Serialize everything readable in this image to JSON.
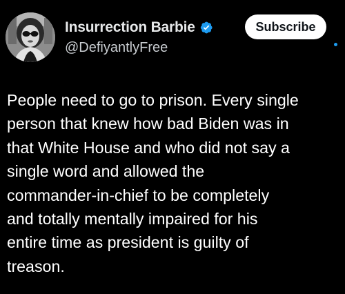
{
  "author": {
    "display_name": "Insurrection Barbie",
    "handle": "@DefiyantlyFree",
    "verified_icon": "verified-badge-icon",
    "avatar_icon": "profile-avatar"
  },
  "actions": {
    "subscribe_label": "Subscribe"
  },
  "post": {
    "lines": [
      "People need to go to prison. Every single",
      "person that knew how bad Biden was in",
      "that White House and who did not say a",
      "single word and allowed the",
      "commander-in-chief to be completely",
      "and totally mentally impaired for his",
      "entire time as president is guilty of",
      "treason."
    ]
  },
  "colors": {
    "background": "#000000",
    "text": "#ffffff",
    "secondary_text": "#c9cdd1",
    "accent": "#1d9bf0",
    "button_bg": "#ffffff",
    "button_text": "#0f1419"
  }
}
